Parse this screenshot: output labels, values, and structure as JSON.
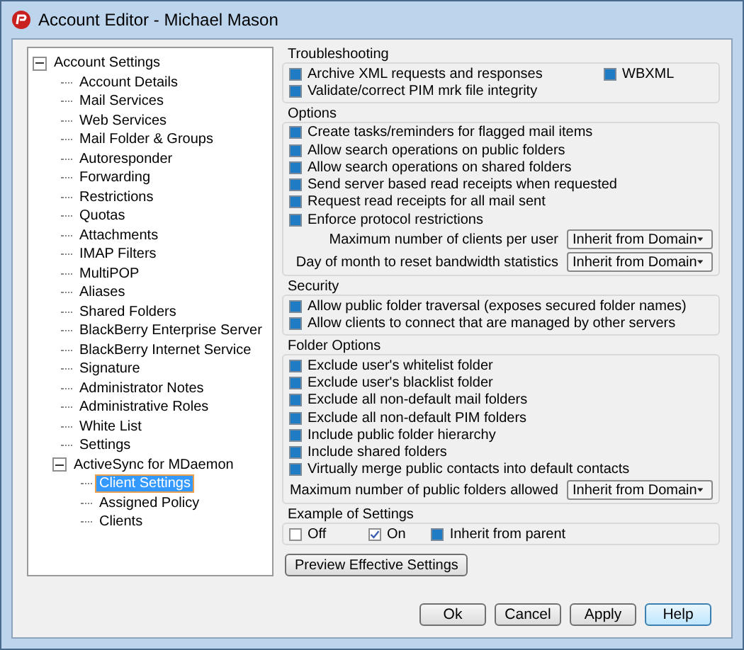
{
  "window": {
    "title": "Account Editor - Michael Mason"
  },
  "tree": [
    {
      "label": "Account Settings",
      "expanded": true,
      "selected": false,
      "children": [
        {
          "label": "Account Details",
          "selected": false
        },
        {
          "label": "Mail Services",
          "selected": false
        },
        {
          "label": "Web Services",
          "selected": false
        },
        {
          "label": "Mail Folder & Groups",
          "selected": false
        },
        {
          "label": "Autoresponder",
          "selected": false
        },
        {
          "label": "Forwarding",
          "selected": false
        },
        {
          "label": "Restrictions",
          "selected": false
        },
        {
          "label": "Quotas",
          "selected": false
        },
        {
          "label": "Attachments",
          "selected": false
        },
        {
          "label": "IMAP Filters",
          "selected": false
        },
        {
          "label": "MultiPOP",
          "selected": false
        },
        {
          "label": "Aliases",
          "selected": false
        },
        {
          "label": "Shared Folders",
          "selected": false
        },
        {
          "label": "BlackBerry Enterprise Server",
          "selected": false
        },
        {
          "label": "BlackBerry Internet Service",
          "selected": false
        },
        {
          "label": "Signature",
          "selected": false
        },
        {
          "label": "Administrator Notes",
          "selected": false
        },
        {
          "label": "Administrative Roles",
          "selected": false
        },
        {
          "label": "White List",
          "selected": false
        },
        {
          "label": "Settings",
          "selected": false
        },
        {
          "label": "ActiveSync for MDaemon",
          "expanded": true,
          "selected": false,
          "children": [
            {
              "label": "Client Settings",
              "selected": true
            },
            {
              "label": "Assigned Policy",
              "selected": false
            },
            {
              "label": "Clients",
              "selected": false
            }
          ]
        }
      ]
    }
  ],
  "groups": [
    {
      "title": "Troubleshooting",
      "items": [
        {
          "label": "Archive XML requests and responses",
          "inherited": true
        },
        {
          "label": "Validate/correct PIM mrk file integrity",
          "inherited": true
        }
      ],
      "side_items": [
        {
          "label": "WBXML",
          "inherited": true
        }
      ]
    },
    {
      "title": "Options",
      "items": [
        {
          "label": "Create tasks/reminders for flagged mail items",
          "inherited": true
        },
        {
          "label": "Allow search operations on public folders",
          "inherited": true
        },
        {
          "label": "Allow search operations on shared folders",
          "inherited": true
        },
        {
          "label": "Send server based read receipts when requested",
          "inherited": true
        },
        {
          "label": "Request read receipts for all mail sent",
          "inherited": true
        },
        {
          "label": "Enforce protocol restrictions",
          "inherited": true
        }
      ],
      "selects": [
        {
          "label": "Maximum number of clients per user",
          "value": "Inherit from Domain"
        },
        {
          "label": "Day of month to reset bandwidth statistics",
          "value": "Inherit from Domain"
        }
      ]
    },
    {
      "title": "Security",
      "items": [
        {
          "label": "Allow public folder traversal (exposes secured folder names)",
          "inherited": true
        },
        {
          "label": "Allow clients to connect that are managed by other servers",
          "inherited": true
        }
      ]
    },
    {
      "title": "Folder Options",
      "items": [
        {
          "label": "Exclude user's whitelist folder",
          "inherited": true
        },
        {
          "label": "Exclude user's blacklist folder",
          "inherited": true
        },
        {
          "label": "Exclude all non-default mail folders",
          "inherited": true
        },
        {
          "label": "Exclude all non-default PIM folders",
          "inherited": true
        },
        {
          "label": "Include public folder hierarchy",
          "inherited": true
        },
        {
          "label": "Include shared folders",
          "inherited": true
        },
        {
          "label": "Virtually merge public contacts into default contacts",
          "inherited": true
        }
      ],
      "selects": [
        {
          "label": "Maximum number of public folders allowed",
          "value": "Inherit from Domain"
        }
      ]
    },
    {
      "title": "Example of Settings",
      "inline": true,
      "items": [
        {
          "label": "Off",
          "checked": false
        },
        {
          "label": "On",
          "checked": true
        },
        {
          "label": "Inherit from parent",
          "inherited": true
        }
      ]
    }
  ],
  "preview_button": "Preview Effective Settings",
  "buttons": [
    {
      "label": "Ok",
      "default": false
    },
    {
      "label": "Cancel",
      "default": false
    },
    {
      "label": "Apply",
      "default": false
    },
    {
      "label": "Help",
      "default": true
    }
  ]
}
